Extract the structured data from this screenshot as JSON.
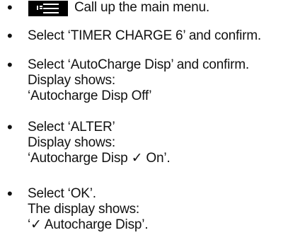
{
  "steps": [
    {
      "lines": [
        "Call up the main menu."
      ]
    },
    {
      "lines": [
        "Select ‘TIMER CHARGE 6’ and confirm."
      ]
    },
    {
      "lines": [
        "Select ‘AutoCharge Disp’ and confirm.",
        "Display shows:",
        "‘Autocharge Disp Off’"
      ]
    },
    {
      "lines": [
        "Select ‘ALTER’",
        "Display shows:",
        "‘Autocharge Disp ✓ On’."
      ]
    },
    {
      "lines": [
        "Select ‘OK’.",
        "The display shows:",
        "‘✓ Autocharge Disp’."
      ]
    }
  ],
  "icons": {
    "menu_icon": "main-menu-icon"
  }
}
